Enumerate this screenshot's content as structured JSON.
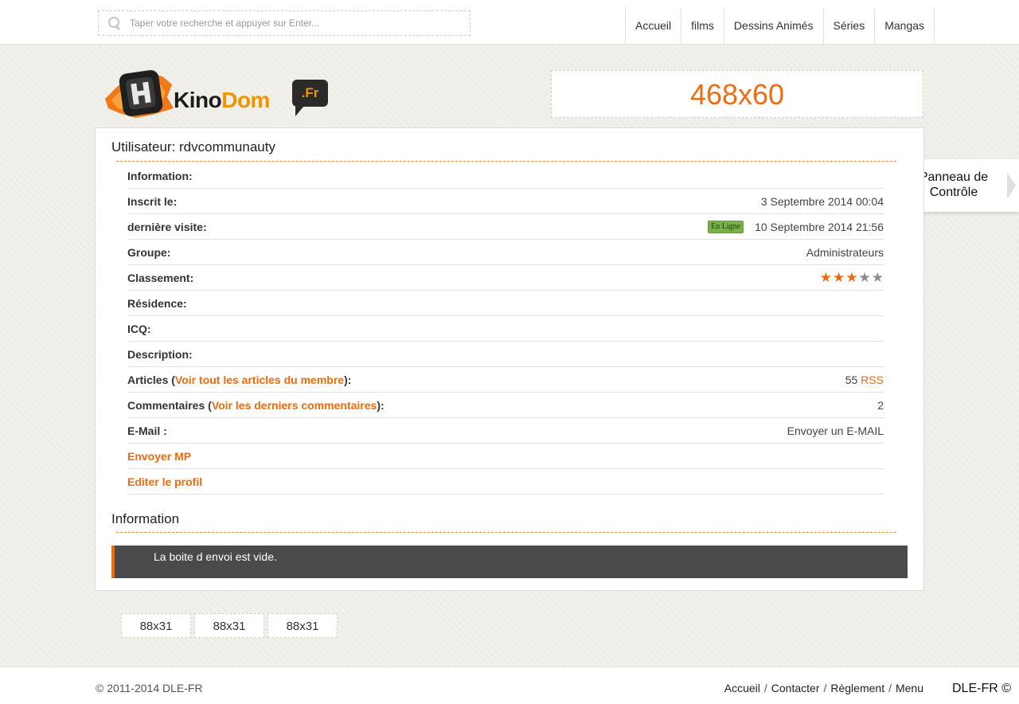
{
  "search": {
    "placeholder": "Taper votre recherche et appuyer sur Enter..."
  },
  "nav": [
    {
      "label": "Accueil"
    },
    {
      "label": "films"
    },
    {
      "label": "Dessins Animés"
    },
    {
      "label": "Séries"
    },
    {
      "label": "Mangas"
    }
  ],
  "logo": {
    "text_a": "Kino",
    "text_b": "Dom",
    "badge": ".Fr"
  },
  "top_banner": "468x60",
  "side_tab": {
    "line1": "Panneau de",
    "line2": "Contrôle"
  },
  "profile": {
    "title": "Utilisateur: rdvcommunauty",
    "rows": {
      "information": {
        "label": "Information:"
      },
      "registered": {
        "label": "Inscrit le:",
        "value": "3 Septembre 2014 00:04"
      },
      "last_visit": {
        "label": "dernière visite:",
        "badge": "En Ligne",
        "value": "10 Septembre 2014 21:56"
      },
      "group": {
        "label": "Groupe:",
        "value": "Administrateurs"
      },
      "rating": {
        "label": "Classement:",
        "stars": 3,
        "max_stars": 5
      },
      "residence": {
        "label": "Résidence:"
      },
      "icq": {
        "label": "ICQ:"
      },
      "description": {
        "label": "Description:"
      },
      "articles": {
        "label_pre": "Articles (",
        "link": "Voir tout les articles du membre",
        "label_post": "):",
        "count": "55",
        "rss": "RSS"
      },
      "comments": {
        "label_pre": "Commentaires (",
        "link": "Voir les derniers commentaires",
        "label_post": "):",
        "count": "2"
      },
      "email": {
        "label": "E-Mail :",
        "link": "Envoyer un E-MAIL"
      },
      "send_pm": {
        "label": "Envoyer MP"
      },
      "edit_profile": {
        "label": "Editer le profil"
      }
    }
  },
  "info_section": {
    "title": "Information",
    "message": "La boite d envoi est vide."
  },
  "mini_banners": [
    "88x31",
    "88x31",
    "88x31"
  ],
  "footer": {
    "copyright": "© 2011-2014 DLE-FR",
    "links": [
      "Accueil",
      "Contacter",
      "Règlement",
      "Menu"
    ],
    "sep": "/",
    "brand": "DLE-FR ©"
  },
  "colors": {
    "accent": "#f06a0c",
    "red": "#d8141b",
    "online_badge": "#7ab04a",
    "info_box": "#4a4a4a"
  }
}
